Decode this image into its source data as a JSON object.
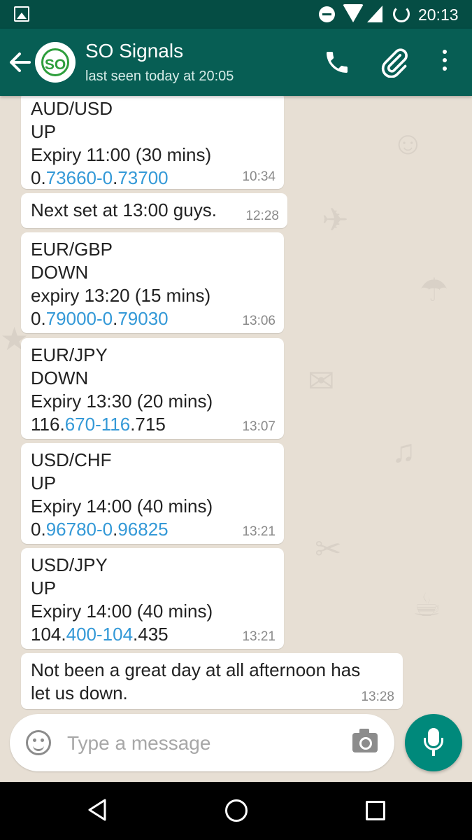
{
  "status_bar": {
    "time": "20:13",
    "icons": [
      "gallery-icon",
      "do-not-disturb-icon",
      "wifi-icon",
      "signal-icon",
      "battery-icon"
    ]
  },
  "header": {
    "title": "SO Signals",
    "subtitle": "last seen today at 20:05",
    "avatar_text": "SO"
  },
  "messages": [
    {
      "lines": [
        "AUD/USD",
        "UP",
        "Expiry 11:00 (30 mins)"
      ],
      "price": {
        "a": "0.",
        "b": "73660-0",
        "c": ".",
        "d": "73700"
      },
      "time": "10:34"
    },
    {
      "lines": [
        "Next set at 13:00 guys."
      ],
      "time": "12:28"
    },
    {
      "lines": [
        "EUR/GBP",
        "DOWN",
        "expiry 13:20 (15 mins)"
      ],
      "price": {
        "a": "0.",
        "b": "79000-0",
        "c": ".",
        "d": "79030"
      },
      "time": "13:06"
    },
    {
      "lines": [
        "EUR/JPY",
        "DOWN",
        "Expiry 13:30 (20 mins)"
      ],
      "price": {
        "a": "116.",
        "b": "670-116",
        "c": ".715",
        "d": ""
      },
      "time": "13:07"
    },
    {
      "lines": [
        "USD/CHF",
        "UP",
        "Expiry 14:00 (40 mins)"
      ],
      "price": {
        "a": "0.",
        "b": "96780-0",
        "c": ".",
        "d": "96825"
      },
      "time": "13:21"
    },
    {
      "lines": [
        "USD/JPY",
        "UP",
        "Expiry 14:00 (40 mins)"
      ],
      "price": {
        "a": "104.",
        "b": "400-104",
        "c": ".435",
        "d": ""
      },
      "time": "13:21"
    },
    {
      "lines": [
        "Not been a great day at all afternoon has",
        "let us down."
      ],
      "time": "13:28"
    }
  ],
  "composer": {
    "placeholder": "Type a message"
  },
  "colors": {
    "header": "#075e54",
    "status_bar": "#054d44",
    "fab": "#00897b",
    "link": "#3499d7",
    "chat_bg": "#e5ddd5"
  }
}
